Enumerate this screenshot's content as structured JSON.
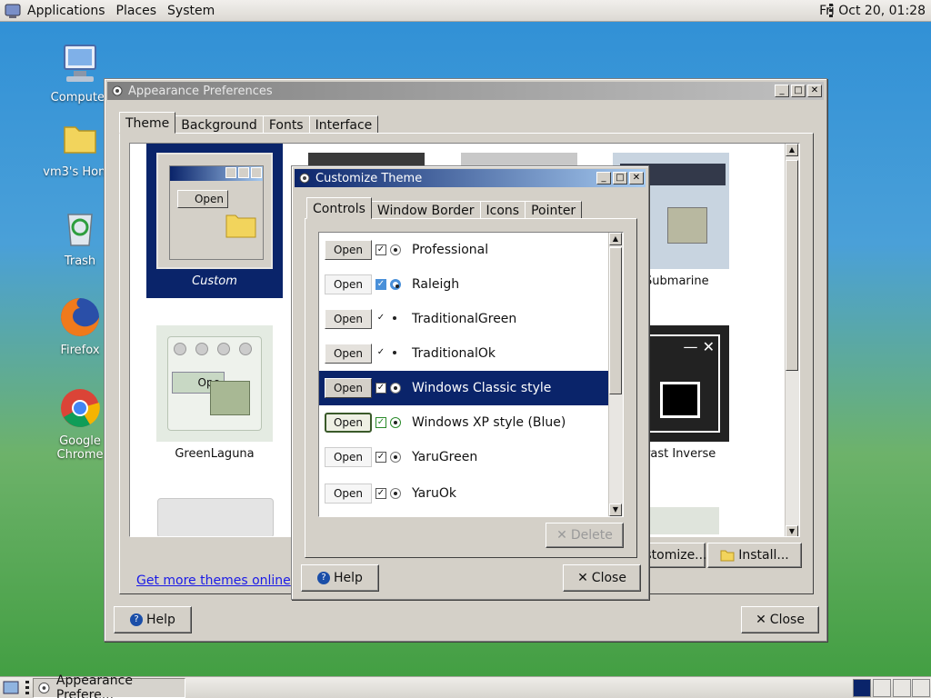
{
  "top_panel": {
    "menus": [
      "Applications",
      "Places",
      "System"
    ],
    "clock": "Fri Oct 20, 01:28"
  },
  "desktop": {
    "icons": [
      {
        "label": "Computer",
        "icon": "computer-icon"
      },
      {
        "label": "vm3's Home",
        "icon": "folder-icon"
      },
      {
        "label": "Trash",
        "icon": "trash-icon"
      },
      {
        "label": "Firefox",
        "icon": "firefox-icon"
      },
      {
        "label": "Google Chrome",
        "icon": "chrome-icon"
      }
    ]
  },
  "appearance": {
    "title": "Appearance Preferences",
    "tabs": [
      "Theme",
      "Background",
      "Fonts",
      "Interface"
    ],
    "themes": [
      {
        "name": "Custom",
        "selected": true
      },
      {
        "name": "Blue-Submarine",
        "shown": "e-Submarine"
      },
      {
        "name": "GreenLaguna"
      },
      {
        "name": "High Contrast Inverse",
        "shown": "ontrast Inverse"
      }
    ],
    "link": "Get more themes online",
    "customize_label": "ustomize...",
    "install_label": "Install...",
    "help_label": "Help",
    "close_label": "Close"
  },
  "customize": {
    "title": "Customize Theme",
    "tabs": [
      "Controls",
      "Window Border",
      "Icons",
      "Pointer"
    ],
    "controls": [
      {
        "name": "Professional",
        "button": "Open"
      },
      {
        "name": "Raleigh",
        "button": "Open"
      },
      {
        "name": "TraditionalGreen",
        "button": "Open"
      },
      {
        "name": "TraditionalOk",
        "button": "Open"
      },
      {
        "name": "Windows Classic style",
        "button": "Open",
        "selected": true
      },
      {
        "name": "Windows XP style (Blue)",
        "button": "Open"
      },
      {
        "name": "YaruGreen",
        "button": "Open"
      },
      {
        "name": "YaruOk",
        "button": "Open"
      }
    ],
    "delete_label": "Delete",
    "help_label": "Help",
    "close_label": "Close"
  },
  "taskbar": {
    "task_label": "Appearance Prefere..."
  },
  "colors": {
    "selection": "#0a246a",
    "window_bg": "#d4d0c8",
    "title_active": "#0a246a"
  }
}
